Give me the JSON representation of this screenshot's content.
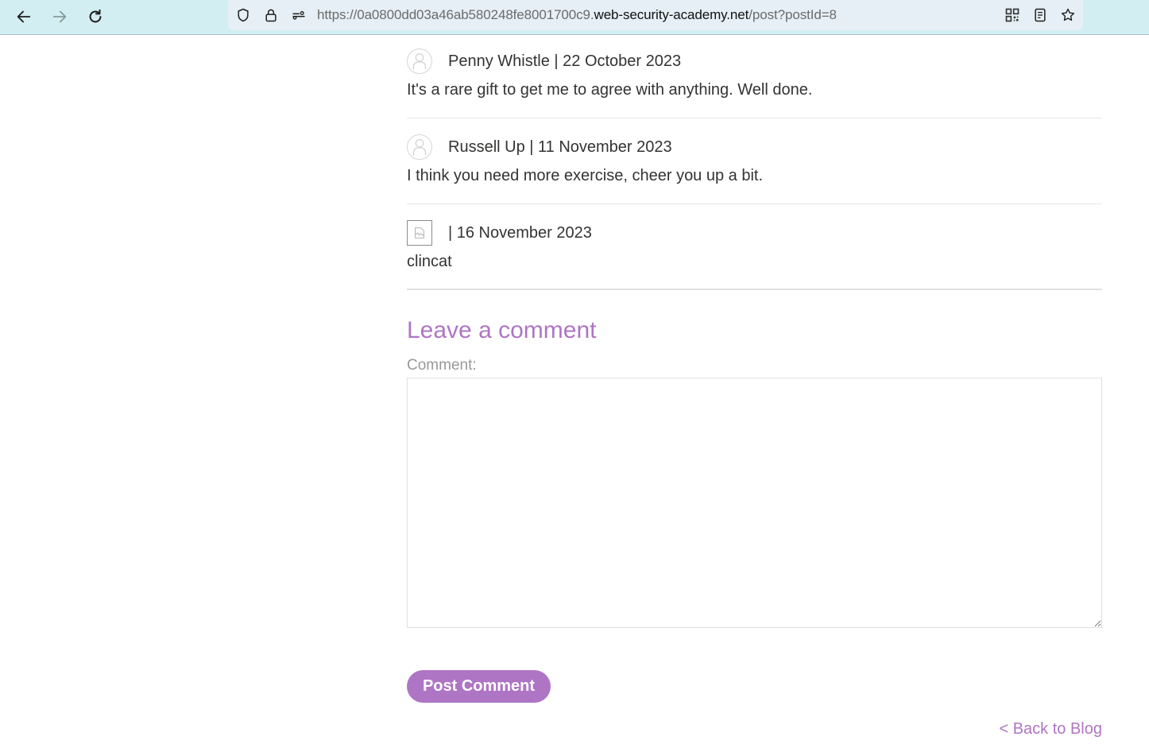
{
  "browser": {
    "url_prefix": "https://0a0800dd03a46ab580248fe8001700c9.",
    "url_domain": "web-security-academy.net",
    "url_path": "/post?postId=8",
    "icons": [
      "back-arrow-icon",
      "forward-arrow-icon",
      "reload-icon",
      "shield-icon",
      "lock-icon",
      "site-permissions-icon",
      "qr-code-icon",
      "reader-view-icon",
      "bookmark-star-icon"
    ]
  },
  "comments": [
    {
      "author": "Penny Whistle",
      "date": "22 October 2023",
      "meta": "Penny Whistle | 22 October 2023",
      "body": "It's a rare gift to get me to agree with anything. Well done.",
      "avatar": "default-avatar-icon"
    },
    {
      "author": "Russell Up",
      "date": "11 November 2023",
      "meta": "Russell Up | 11 November 2023",
      "body": "I think you need more exercise, cheer you up a bit.",
      "avatar": "default-avatar-icon"
    },
    {
      "author": "",
      "date": "16 November 2023",
      "meta": "| 16 November 2023",
      "body": "clincat",
      "avatar": "broken-image-icon"
    }
  ],
  "form": {
    "title": "Leave a comment",
    "comment_label": "Comment:",
    "comment_value": "",
    "submit_label": "Post Comment"
  },
  "footer": {
    "back_link": "< Back to Blog"
  },
  "colors": {
    "accent": "#ae75c5",
    "toolbar": "#d2eef2",
    "text": "#333332"
  }
}
